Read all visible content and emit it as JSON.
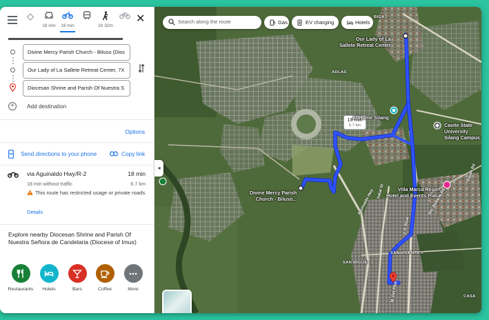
{
  "travel_modes": [
    {
      "name": "best",
      "time": ""
    },
    {
      "name": "driving",
      "time": "18 min"
    },
    {
      "name": "two-wheeler",
      "time": "18 min",
      "active": true
    },
    {
      "name": "transit",
      "time": ""
    },
    {
      "name": "walking",
      "time": "1h 32m"
    },
    {
      "name": "cycling",
      "time": ""
    }
  ],
  "stops": [
    {
      "value": "Divine Mercy Parish Church - Biluso (Dioc"
    },
    {
      "value": "Our Lady of La Sallete Retreat Center, 7X"
    },
    {
      "value": "Diocesan Shrine and Parish Of Nuestra S"
    }
  ],
  "add_destination": "Add destination",
  "options": "Options",
  "send_directions": "Send directions to your phone",
  "copy_link": "Copy link",
  "route": {
    "via": "via Aguinaldo Hwy/R-2",
    "duration": "18 min",
    "subtitle": "18 min without traffic",
    "distance": "6.7 km",
    "warning": "This route has restricted usage or private roads.",
    "details": "Details"
  },
  "explore": "Explore nearby Diocesan Shrine and Parish Of Nuestra Señora de Candelaria (Diocese of Imus)",
  "categories": [
    {
      "label": "Restaurants",
      "color": "#188038",
      "icon": "fork-knife-icon"
    },
    {
      "label": "Hotels",
      "color": "#12b5cb",
      "icon": "bed-icon"
    },
    {
      "label": "Bars",
      "color": "#d93025",
      "icon": "cocktail-icon"
    },
    {
      "label": "Coffee",
      "color": "#b06000",
      "icon": "coffee-icon"
    },
    {
      "label": "More",
      "color": "#70757a",
      "icon": "more-icon"
    }
  ],
  "map": {
    "search_placeholder": "Search along the route",
    "chips": [
      "Gas",
      "EV charging",
      "Hotels"
    ],
    "places": {
      "retreat": "Our Lady of La\nSallete Retreat Center",
      "allhome": "AllHome Silang",
      "cavite": "Cavite State\nUniversity\nSilang Campus",
      "villa": "Villa Marca Resort\nHotel and Events Place",
      "divine": "Divine Mercy Parish\nChurch - Biluso..."
    },
    "areas": [
      "ADLAS",
      "SAN VICENTE II",
      "SAN MIGUEL I",
      "BIGA I",
      "CASA"
    ],
    "roads": [
      "Aguinaldo Hwy",
      "Yakal St",
      "M. Del Pilar",
      "J. P. Rizal",
      "Sto. Rosario Rd",
      "Bayan Rd"
    ],
    "route_time": "18 min",
    "route_distance": "6.7 km",
    "route_color": "#2748f5"
  }
}
